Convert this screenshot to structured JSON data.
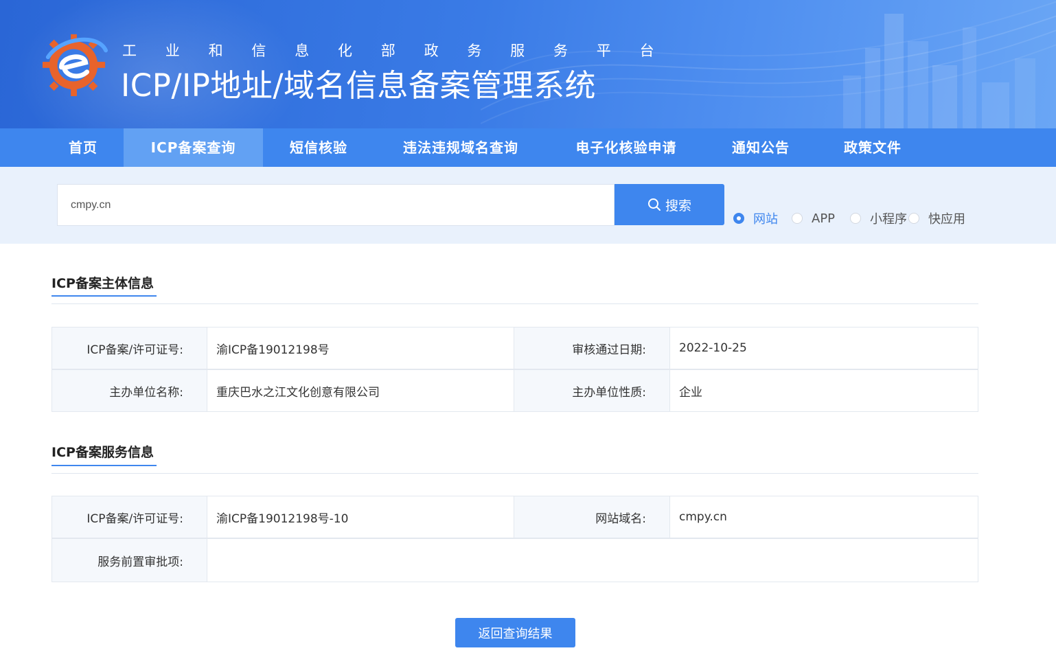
{
  "header": {
    "subtitle_chars": [
      "工",
      "业",
      "和",
      "信",
      "息",
      "化",
      "部",
      "政",
      "务",
      "服",
      "务",
      "平",
      "台"
    ],
    "title": "ICP/IP地址/域名信息备案管理系统"
  },
  "nav": {
    "items": [
      {
        "label": "首页"
      },
      {
        "label": "ICP备案查询",
        "active": true
      },
      {
        "label": "短信核验"
      },
      {
        "label": "违法违规域名查询"
      },
      {
        "label": "电子化核验申请"
      },
      {
        "label": "通知公告"
      },
      {
        "label": "政策文件"
      }
    ]
  },
  "search": {
    "value": "cmpy.cn",
    "button_label": "搜索",
    "options": [
      {
        "label": "网站",
        "checked": true
      },
      {
        "label": "APP",
        "checked": false
      },
      {
        "label": "小程序",
        "checked": false
      },
      {
        "label": "快应用",
        "checked": false
      }
    ]
  },
  "subject_info": {
    "title": "ICP备案主体信息",
    "rows": [
      {
        "label1": "ICP备案/许可证号:",
        "value1": "渝ICP备19012198号",
        "label2": "审核通过日期:",
        "value2": "2022-10-25"
      },
      {
        "label1": "主办单位名称:",
        "value1": "重庆巴水之江文化创意有限公司",
        "label2": "主办单位性质:",
        "value2": "企业"
      }
    ]
  },
  "service_info": {
    "title": "ICP备案服务信息",
    "rows": [
      {
        "label1": "ICP备案/许可证号:",
        "value1": "渝ICP备19012198号-10",
        "label2": "网站域名:",
        "value2": "cmpy.cn"
      },
      {
        "label1": "服务前置审批项:",
        "value1": ""
      }
    ]
  },
  "back_button": "返回查询结果",
  "colors": {
    "primary": "#3e86ee",
    "nav_active": "#62a1f3",
    "search_band": "#e9f1fc",
    "label_bg": "#f5f8fc"
  }
}
